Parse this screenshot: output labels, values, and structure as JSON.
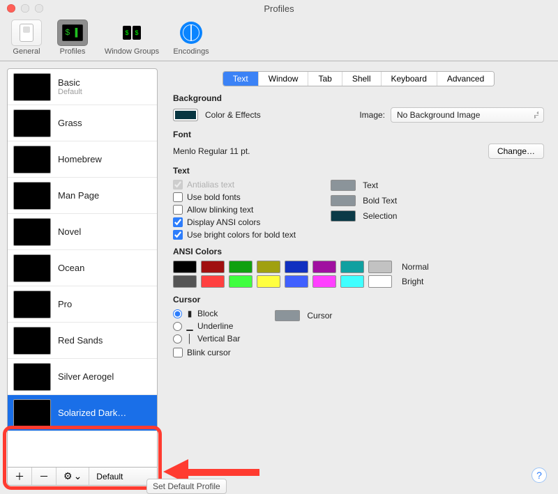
{
  "window": {
    "title": "Profiles"
  },
  "toolbar": {
    "items": [
      {
        "label": "General"
      },
      {
        "label": "Profiles"
      },
      {
        "label": "Window Groups"
      },
      {
        "label": "Encodings"
      }
    ]
  },
  "sidebar": {
    "profiles": [
      {
        "name": "Basic",
        "sub": "Default",
        "thumb": "th-basic"
      },
      {
        "name": "Grass",
        "sub": "",
        "thumb": "th-grass"
      },
      {
        "name": "Homebrew",
        "sub": "",
        "thumb": "th-homebrew"
      },
      {
        "name": "Man Page",
        "sub": "",
        "thumb": "th-manpage"
      },
      {
        "name": "Novel",
        "sub": "",
        "thumb": "th-novel"
      },
      {
        "name": "Ocean",
        "sub": "",
        "thumb": "th-ocean"
      },
      {
        "name": "Pro",
        "sub": "",
        "thumb": "th-pro"
      },
      {
        "name": "Red Sands",
        "sub": "",
        "thumb": "th-redsands"
      },
      {
        "name": "Silver Aerogel",
        "sub": "",
        "thumb": "th-silver"
      },
      {
        "name": "Solarized Dark…",
        "sub": "",
        "thumb": "th-solarized",
        "selected": true
      }
    ],
    "listbar": {
      "add": "＋",
      "remove": "－",
      "gear": "⚙︎",
      "caret": "⌄",
      "default_label": "Default"
    }
  },
  "panel": {
    "tabs": [
      "Text",
      "Window",
      "Tab",
      "Shell",
      "Keyboard",
      "Advanced"
    ],
    "active_tab": 0,
    "section_background": "Background",
    "color_effects_label": "Color & Effects",
    "image_label": "Image:",
    "image_popup_value": "No Background Image",
    "section_font": "Font",
    "font_description": "Menlo Regular 11 pt.",
    "change_button": "Change…",
    "section_text": "Text",
    "text_checks": {
      "antialias": {
        "label": "Antialias text",
        "checked": true,
        "disabled": true
      },
      "bold": {
        "label": "Use bold fonts",
        "checked": false,
        "disabled": false
      },
      "blink": {
        "label": "Allow blinking text",
        "checked": false,
        "disabled": false
      },
      "ansi": {
        "label": "Display ANSI colors",
        "checked": true,
        "disabled": false
      },
      "brightbold": {
        "label": "Use bright colors for bold text",
        "checked": true,
        "disabled": false
      }
    },
    "text_swatches": {
      "text": {
        "label": "Text",
        "color": "#8b949a"
      },
      "boldtext": {
        "label": "Bold Text",
        "color": "#8b949a"
      },
      "selection": {
        "label": "Selection",
        "color": "#0b3a47"
      }
    },
    "section_ansi": "ANSI Colors",
    "ansi": {
      "normal_label": "Normal",
      "bright_label": "Bright",
      "normal": [
        "#000000",
        "#a01010",
        "#10a010",
        "#a0a010",
        "#1030c0",
        "#a010a0",
        "#10a0a0",
        "#c2c2c2"
      ],
      "bright": [
        "#555555",
        "#ff4040",
        "#40ff40",
        "#ffff40",
        "#4060ff",
        "#ff40ff",
        "#40ffff",
        "#ffffff"
      ]
    },
    "section_cursor": "Cursor",
    "cursor": {
      "options": [
        {
          "value": "block",
          "label": "Block",
          "glyph": "▮"
        },
        {
          "value": "underline",
          "label": "Underline",
          "glyph": "▁"
        },
        {
          "value": "vbar",
          "label": "Vertical Bar",
          "glyph": "│"
        }
      ],
      "selected": "block",
      "blink_label": "Blink cursor",
      "blink_checked": false,
      "swatch_label": "Cursor",
      "swatch_color": "#8b949a"
    },
    "help_symbol": "?",
    "set_default_label": "Set Default Profile"
  }
}
